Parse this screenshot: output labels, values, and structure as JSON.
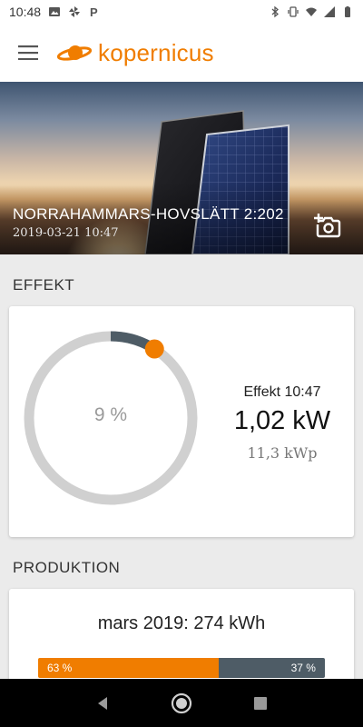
{
  "status_bar": {
    "time": "10:48",
    "left_icons": [
      "image-icon",
      "pinwheel-icon",
      "parking-icon"
    ],
    "right_icons": [
      "bluetooth-icon",
      "vibrate-icon",
      "wifi-icon",
      "signal-icon",
      "battery-icon"
    ]
  },
  "app_bar": {
    "menu_icon": "hamburger-menu-icon",
    "brand": "kopernicus",
    "brand_color": "#f07d00"
  },
  "hero": {
    "title": "NORRAHAMMARS-HOVSLÄTT 2:202",
    "date": "2019-03-21 10:47",
    "action_icon": "add-photo-icon"
  },
  "effect": {
    "section_label": "EFFEKT",
    "percent": 9,
    "percent_label": "9 %",
    "label": "Effekt 10:47",
    "value": "1,02 kW",
    "peak": "11,3 kWp",
    "track_color": "#d0d0d0",
    "fill_color": "#4e5c66",
    "knob_color": "#f07d00"
  },
  "production": {
    "section_label": "PRODUKTION",
    "title": "mars 2019: 274 kWh",
    "left_fraction": 0.63,
    "left_label": "63 %",
    "right_label": "37 %",
    "left_color": "#f07d00",
    "right_color": "#4e5c66"
  },
  "nav_bar": {
    "items": [
      "back-icon",
      "home-icon",
      "recents-icon"
    ]
  }
}
